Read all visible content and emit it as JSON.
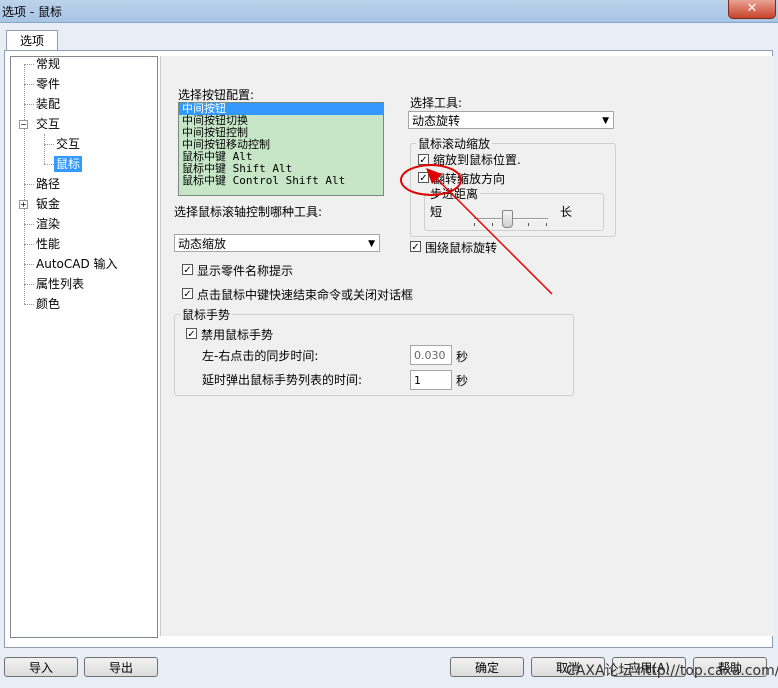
{
  "window": {
    "title": "选项 - 鼠标",
    "close_glyph": "✕"
  },
  "tab": {
    "label": "选项"
  },
  "tree": {
    "items": [
      {
        "label": "常规"
      },
      {
        "label": "零件"
      },
      {
        "label": "装配"
      },
      {
        "label": "交互",
        "expander": "−"
      },
      {
        "label": "交互"
      },
      {
        "label": "鼠标",
        "selected": true
      },
      {
        "label": "路径"
      },
      {
        "label": "钣金",
        "expander": "+"
      },
      {
        "label": "渲染"
      },
      {
        "label": "性能"
      },
      {
        "label": "AutoCAD 输入"
      },
      {
        "label": "属性列表"
      },
      {
        "label": "颜色"
      }
    ]
  },
  "button_config": {
    "label": "选择按钮配置:",
    "options": [
      "中间按钮",
      "中间按钮切换",
      "中间按钮控制",
      "中间按钮移动控制",
      "鼠标中键 Alt",
      "鼠标中键 Shift Alt",
      "鼠标中键 Control Shift Alt"
    ],
    "selected_index": 0
  },
  "tool_select": {
    "label": "选择工具:",
    "value": "动态旋转"
  },
  "scroll_zoom": {
    "group_label": "鼠标滚动缩放",
    "zoom_to_cursor_label": "缩放到鼠标位置.",
    "zoom_to_cursor_checked": "✓",
    "reverse_zoom_label": "翻转缩放方向",
    "reverse_zoom_checked": "✓",
    "step_label": "步进距离",
    "short_label": "短",
    "long_label": "长",
    "step_level": 0.45
  },
  "rotate_around_cursor": {
    "label": "围绕鼠标旋转",
    "checked": "✓"
  },
  "wheel_tool": {
    "label": "选择鼠标滚轴控制哪种工具:",
    "value": "动态缩放"
  },
  "show_part_name": {
    "label": "显示零件名称提示",
    "checked": "✓"
  },
  "middle_click_end": {
    "label": "点击鼠标中键快速结束命令或关闭对话框",
    "checked": "✓"
  },
  "gestures": {
    "group_label": "鼠标手势",
    "disable_label": "禁用鼠标手势",
    "disable_checked": "✓",
    "sync_time_label": "左-右点击的同步时间:",
    "sync_time_value": "0.030",
    "sync_time_unit": "秒",
    "delay_label": "延时弹出鼠标手势列表的时间:",
    "delay_value": "1",
    "delay_unit": "秒"
  },
  "combo_arrow": "▼",
  "footer": {
    "import_label": "导入",
    "export_label": "导出",
    "ok_label": "确定",
    "cancel_label": "取消",
    "apply_label": "应用(A)",
    "help_label": "帮助"
  },
  "watermark": "CAXA论坛 http://top.caxa.com/",
  "colors": {
    "annotation": "#e00000",
    "list_background": "#c7e6c7",
    "selection": "#3399ff"
  }
}
